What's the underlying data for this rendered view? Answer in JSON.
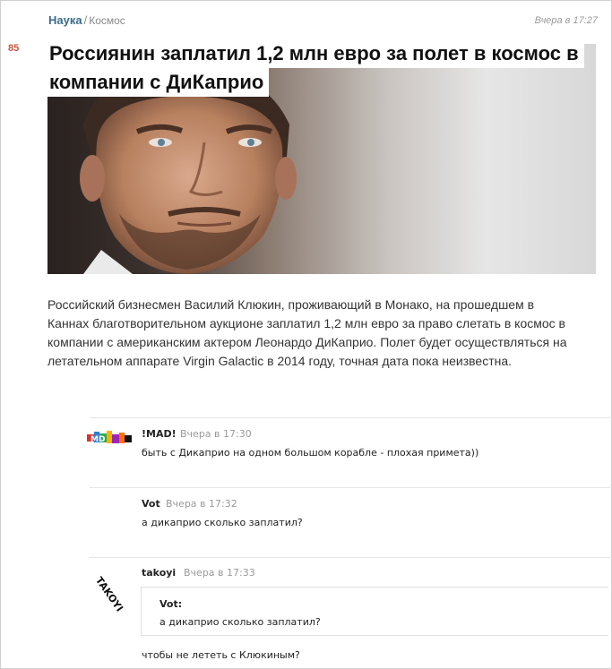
{
  "post": {
    "score": "85",
    "category": "Наука",
    "separator": "/",
    "subcategory": "Космос",
    "time": "Вчера в 17:27",
    "title_line1": "Россиянин заплатил 1,2 млн евро за полет в космос в",
    "title_line2": "компании с ДиКаприо",
    "lead_line1": "Российский бизнесмен Василий Клюкин, проживающий в Монако, на прошедшем в",
    "lead_line2": "Каннах благотворительном аукционе заплатил 1,2 млн евро за право слетать в космос в",
    "lead_line3": "компании с американским актером Леонардо ДиКаприо. Полет будет осуществляться на",
    "lead_line4": "летательном аппарате Virgin Galactic в 2014 году, точная дата пока неизвестна."
  },
  "comments": [
    {
      "author": "!MAD!",
      "time": "Вчера в 17:30",
      "text": "быть с Дикаприо на одном большом корабле - плохая примета))",
      "avatar": "colorful-logo-icon"
    },
    {
      "author": "Vot",
      "time": "Вчера в 17:32",
      "text": "а дикаприо сколько заплатил?",
      "avatar": "none"
    },
    {
      "author": "takoyi",
      "time": "Вчера в 17:33",
      "avatar": "takoyi-text-logo-icon",
      "avatar_text": "TAKOYI",
      "quote": {
        "author": "Vot:",
        "text": "а дикаприо сколько заплатил?"
      },
      "text": "чтобы не лететь с Клюкиным?"
    }
  ],
  "colors": {
    "category_link": "#3b6a8f",
    "score": "#c8553d",
    "muted": "#9a9a9a"
  }
}
